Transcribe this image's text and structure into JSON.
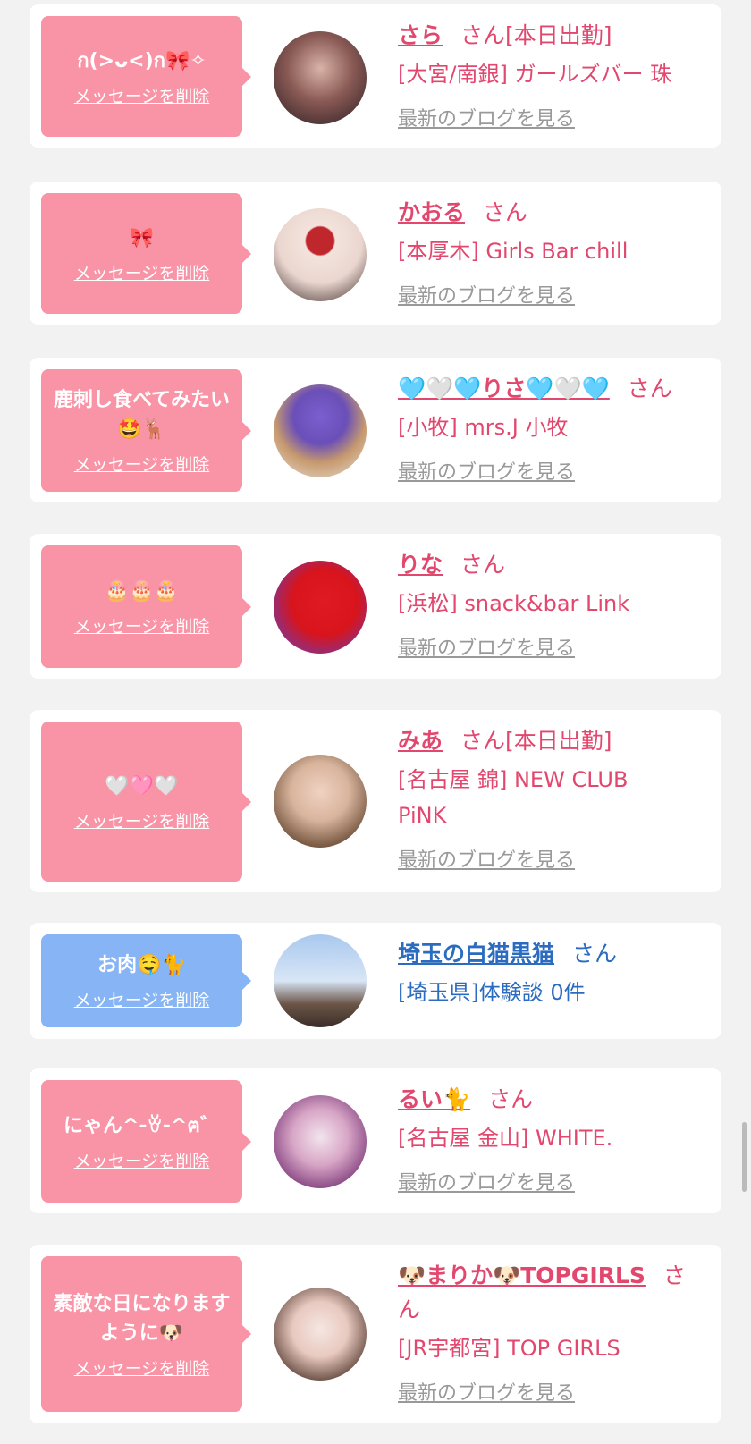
{
  "delete_label": "メッセージを削除",
  "blog_label": "最新のブログを見る",
  "san_label": "さん",
  "colors": {
    "pink_bubble": "#f993a6",
    "blue_bubble": "#86b4f5",
    "name_pink": "#e2476e",
    "name_blue": "#2c6cc0"
  },
  "cards": [
    {
      "message": "ก(>ᴗ<)ก🎀✧",
      "name": "さら",
      "suffix": "[本日出勤]",
      "shop": "[大宮/南銀] ガールズバー 珠",
      "blog": true,
      "type": "pink"
    },
    {
      "message": "🎀",
      "name": "かおる",
      "suffix": "",
      "shop": "[本厚木] Girls Bar chill",
      "blog": true,
      "type": "pink"
    },
    {
      "message": "鹿刺し食べてみたい🤩🦌",
      "name": "🩵🤍🩵りさ🩵🤍🩵",
      "suffix": "",
      "shop": "[小牧] mrs.J 小牧",
      "blog": true,
      "type": "pink"
    },
    {
      "message": "🎂🎂🎂",
      "name": "りな",
      "suffix": "",
      "shop": "[浜松] snack&bar Link",
      "blog": true,
      "type": "pink"
    },
    {
      "message": "🤍🩷🤍",
      "name": "みあ",
      "suffix": "[本日出勤]",
      "shop": "[名古屋 錦] NEW CLUB PiNK",
      "blog": true,
      "type": "pink"
    },
    {
      "message": "お肉🤤🐈",
      "name": "埼玉の白猫黒猫",
      "suffix": "",
      "shop": "[埼玉県]体験談 0件",
      "blog": false,
      "type": "blue"
    },
    {
      "message": "にゃん^-ꈊ-^ฅ゛",
      "name": "るい🐈",
      "suffix": "",
      "shop": "[名古屋 金山] WHITE.",
      "blog": true,
      "type": "pink"
    },
    {
      "message": "素敵な日になりますように🐶",
      "name": "🐶まりか🐶TOPGIRLS",
      "suffix": "",
      "shop": "[JR宇都宮] TOP GIRLS",
      "blog": true,
      "type": "pink"
    }
  ]
}
